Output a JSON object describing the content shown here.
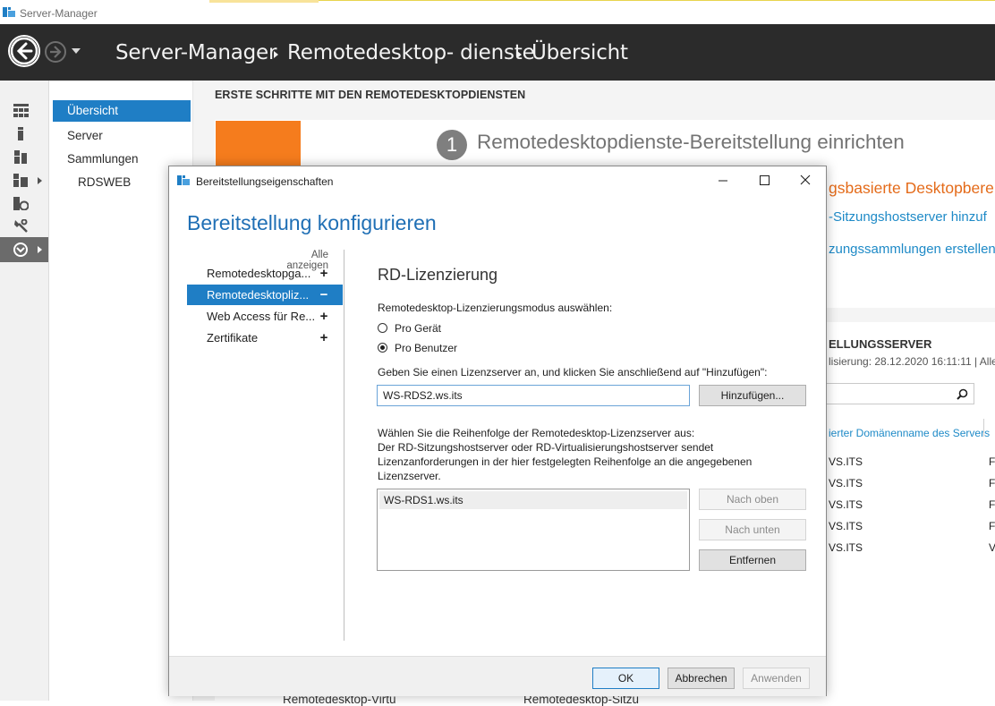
{
  "window": {
    "title": "Server-Manager"
  },
  "header": {
    "breadcrumb": [
      "Server-Manager",
      "Remotedesktop- dienste",
      "Übersicht"
    ]
  },
  "rail": {
    "icons": [
      "dashboard-icon",
      "local-server-icon",
      "all-servers-icon",
      "file-services-icon",
      "iis-icon",
      "tools-icon",
      "remote-desktop-icon"
    ]
  },
  "nav": {
    "items": [
      {
        "label": "Übersicht",
        "selected": true
      },
      {
        "label": "Server",
        "selected": false
      },
      {
        "label": "Sammlungen",
        "selected": false
      },
      {
        "label": "RDSWEB",
        "selected": false
      }
    ]
  },
  "background": {
    "section_title": "ERSTE SCHRITTE MIT DEN REMOTEDESKTOPDIENSTEN",
    "step_number": "1",
    "step_title": "Remotedesktopdienste-Bereitstellung einrichten",
    "link_1": "gsbasierte Desktopbereit",
    "link_2": "-Sitzungshostserver hinzuf",
    "link_3": "zungssammlungen erstellen",
    "server_title": "ELLUNGSSERVER",
    "server_subtitle": "lisierung: 28.12.2020 16:11:11 | Alle",
    "column_header": "ierter Domänenname des Servers",
    "rows": [
      "VS.ITS",
      "VS.ITS",
      "VS.ITS",
      "VS.ITS",
      "VS.ITS"
    ],
    "rows_col2": [
      "F",
      "F",
      "F",
      "F",
      "V"
    ],
    "bottom_label_1": "Remotedesktop-Virtu",
    "bottom_label_2": "Remotedesktop-Sitzu"
  },
  "dialog": {
    "title": "Bereitstellungseigenschaften",
    "heading": "Bereitstellung konfigurieren",
    "show_all": "Alle anzeigen",
    "left_items": [
      {
        "label": "Remotedesktopga...",
        "sign": "+",
        "selected": false
      },
      {
        "label": "Remotedesktopliz...",
        "sign": "−",
        "selected": true
      },
      {
        "label": "Web Access für Re...",
        "sign": "+",
        "selected": false
      },
      {
        "label": "Zertifikate",
        "sign": "+",
        "selected": false
      }
    ],
    "section_title": "RD-Lizenzierung",
    "mode_label": "Remotedesktop-Lizenzierungsmodus auswählen:",
    "radio_options": [
      {
        "label": "Pro Gerät",
        "checked": false
      },
      {
        "label": "Pro Benutzer",
        "checked": true
      }
    ],
    "server_prompt": "Geben Sie einen Lizenzserver an, und klicken Sie anschließend auf \"Hinzufügen\":",
    "server_input_value": "WS-RDS2.ws.its",
    "add_button": "Hinzufügen...",
    "order_description": [
      "Wählen Sie die Reihenfolge der Remotedesktop-Lizenzserver aus:",
      "Der RD-Sitzungshostserver oder RD-Virtualisierungshostserver sendet",
      "Lizenzanforderungen in der hier festgelegten Reihenfolge an die angegebenen",
      "Lizenzserver."
    ],
    "order_list": [
      "WS-RDS1.ws.its"
    ],
    "move_up_button": "Nach oben",
    "move_down_button": "Nach unten",
    "remove_button": "Entfernen",
    "ok_button": "OK",
    "cancel_button": "Abbrechen",
    "apply_button": "Anwenden"
  }
}
